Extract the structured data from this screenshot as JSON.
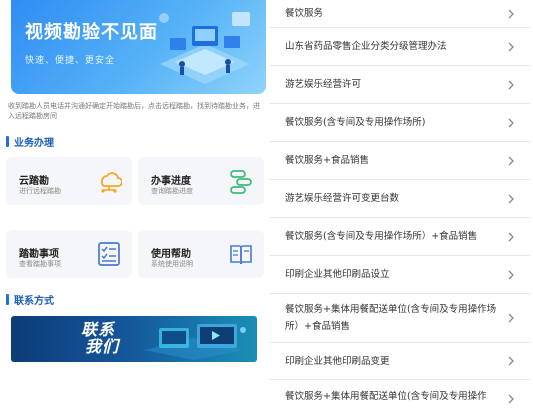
{
  "banner": {
    "title": "视频勘验不见面",
    "subtitle": "快速、便捷、更安全"
  },
  "description": "收到踏勘人员电话并沟通好确定开始踏勘后，点击远程踏勘，找到待踏勘业务，进入远程踏勘房间",
  "business_section": {
    "title": "业务办理"
  },
  "cards": [
    {
      "title": "云踏勘",
      "subtitle": "进行远程踏勘",
      "icon": "cloud-network-icon"
    },
    {
      "title": "办事进度",
      "subtitle": "查询踏勘进度",
      "icon": "progress-flow-icon"
    },
    {
      "title": "踏勘事项",
      "subtitle": "查看踏勘事项",
      "icon": "checklist-icon"
    },
    {
      "title": "使用帮助",
      "subtitle": "系统使用说明",
      "icon": "help-book-icon"
    }
  ],
  "contact_section": {
    "title": "联系方式"
  },
  "contact_banner": {
    "line1": "联系",
    "line2": "我们"
  },
  "items": [
    {
      "label": "餐饮服务"
    },
    {
      "label": "山东省药品零售企业分类分级管理办法"
    },
    {
      "label": "游艺娱乐经营许可"
    },
    {
      "label": "餐饮服务(含专间及专用操作场所)"
    },
    {
      "label": "餐饮服务+食品销售"
    },
    {
      "label": "游艺娱乐经营许可变更台数"
    },
    {
      "label": "餐饮服务(含专间及专用操作场所）+食品销售"
    },
    {
      "label": "印刷企业其他印刷品设立"
    },
    {
      "label": "餐饮服务+集体用餐配送单位(含专间及专用操作场所）+食品销售"
    },
    {
      "label": "印刷企业其他印刷品变更"
    },
    {
      "label": "餐饮服务+集体用餐配送单位(含专间及专用操作"
    }
  ],
  "colors": {
    "accent": "#1f6fd6",
    "card_icon_orange": "#f5a623",
    "card_icon_green": "#3dbb7a",
    "card_icon_blue": "#4a78d6"
  }
}
